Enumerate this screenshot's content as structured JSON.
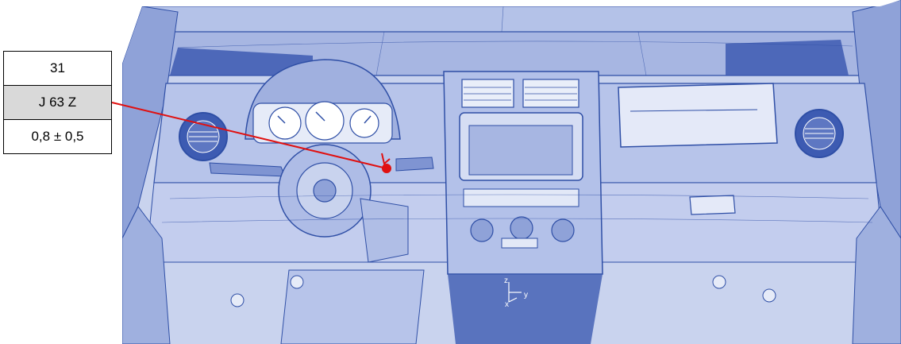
{
  "callout": {
    "number": "31",
    "code": "J 63 Z",
    "tolerance": "0,8 ± 0,5"
  },
  "axes": {
    "z": "z",
    "y": "y",
    "x": "x"
  },
  "colors": {
    "wireframe": "#2f4fa6",
    "fill_light": "#c9d3ee",
    "fill_mid": "#a7b6e2",
    "fill_dark": "#3d5bb2",
    "leader": "#e01010",
    "code_cell": "#d9d9d9"
  }
}
